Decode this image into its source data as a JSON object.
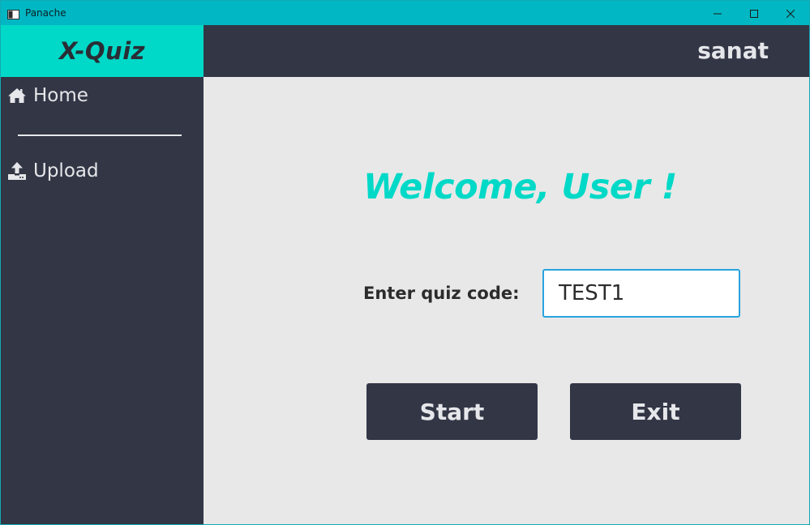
{
  "window": {
    "title": "Panache",
    "controls": {
      "minimize_icon": "minimize-icon",
      "maximize_icon": "maximize-icon",
      "close_icon": "close-icon"
    },
    "titlebar_color": "#00b7c3"
  },
  "brand": {
    "name": "X-Quiz",
    "color": "#00d9c7"
  },
  "header": {
    "username": "sanat"
  },
  "sidebar": {
    "items": [
      {
        "label": "Home",
        "icon": "home-icon"
      },
      {
        "label": "Upload",
        "icon": "upload-icon"
      }
    ],
    "background": "#323645"
  },
  "main": {
    "welcome": "Welcome, User !",
    "code_label": "Enter quiz code:",
    "code_value": "TEST1",
    "start_label": "Start",
    "exit_label": "Exit"
  },
  "colors": {
    "accent": "#00d9c7",
    "dark": "#323645",
    "content_bg": "#e8e8e8",
    "input_focus": "#29a3df"
  }
}
